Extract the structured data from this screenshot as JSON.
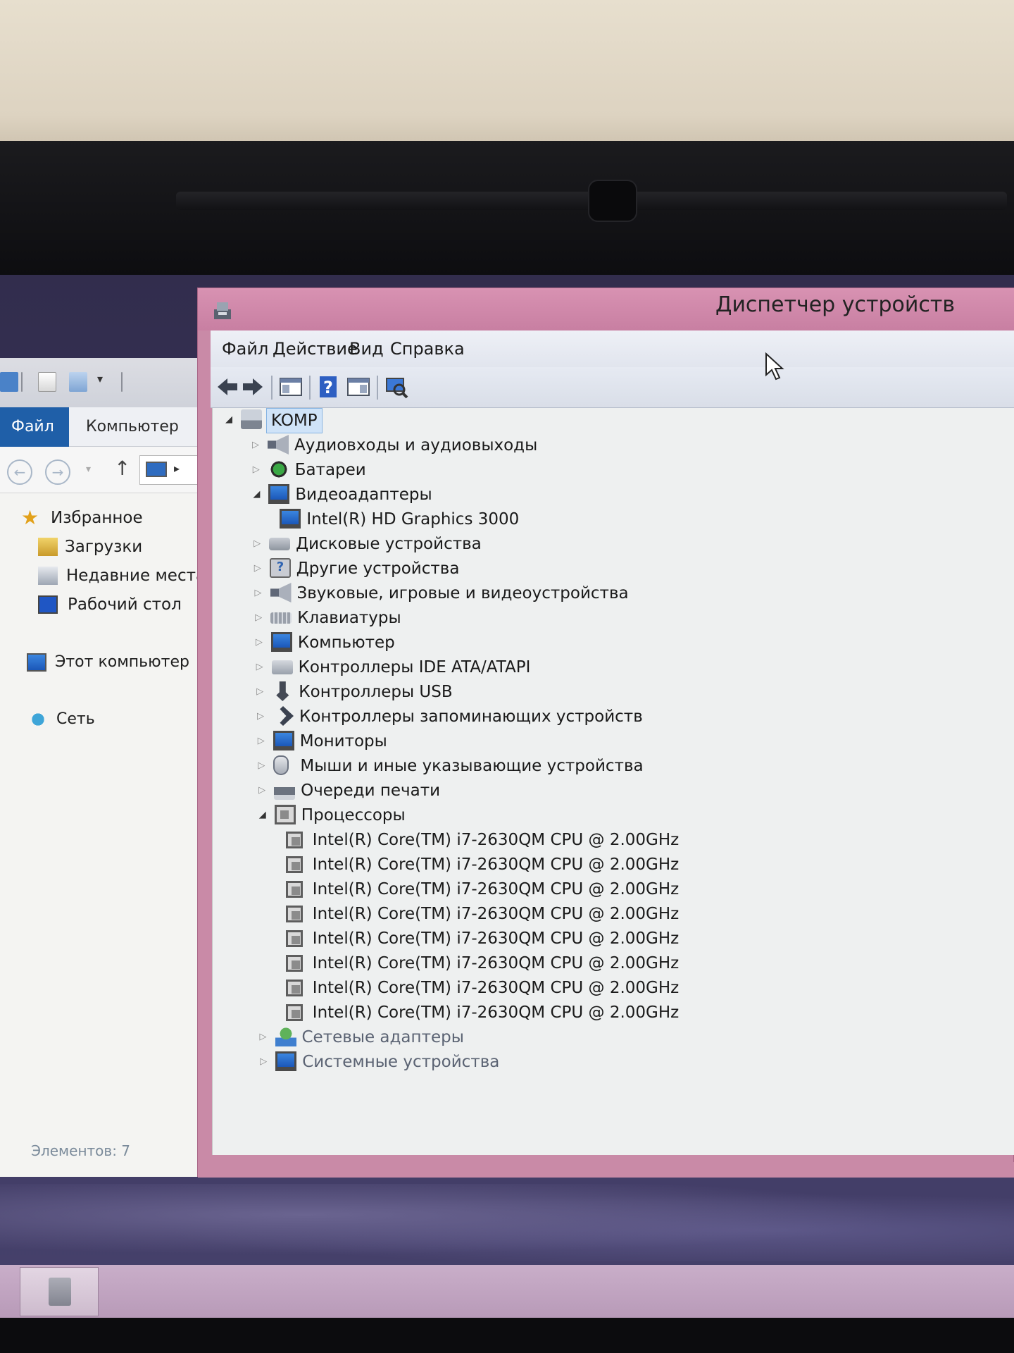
{
  "explorer": {
    "tabs": {
      "file": "Файл",
      "computer": "Компьютер"
    },
    "nav": {
      "favorites": "Избранное",
      "downloads": "Загрузки",
      "recent": "Недавние места",
      "desktop": "Рабочий стол",
      "this_pc": "Этот компьютер",
      "network": "Сеть"
    },
    "status": "Элементов: 7"
  },
  "device_manager": {
    "title": "Диспетчер устройств",
    "menu": [
      "Файл",
      "Действие",
      "Вид",
      "Справка"
    ],
    "tree": {
      "root": "KOMP",
      "categories": [
        {
          "label": "Аудиовходы и аудиовыходы",
          "icon": "speaker-icon",
          "expanded": false
        },
        {
          "label": "Батареи",
          "icon": "battery-icon",
          "expanded": false
        },
        {
          "label": "Видеоадаптеры",
          "icon": "monitor-icon",
          "expanded": true,
          "children": [
            "Intel(R) HD Graphics 3000"
          ]
        },
        {
          "label": "Дисковые устройства",
          "icon": "disk-icon",
          "expanded": false
        },
        {
          "label": "Другие устройства",
          "icon": "unknown-device-icon",
          "expanded": false
        },
        {
          "label": "Звуковые, игровые и видеоустройства",
          "icon": "speaker-icon",
          "expanded": false
        },
        {
          "label": "Клавиатуры",
          "icon": "keyboard-icon",
          "expanded": false
        },
        {
          "label": "Компьютер",
          "icon": "monitor-icon",
          "expanded": false
        },
        {
          "label": "Контроллеры IDE ATA/ATAPI",
          "icon": "ide-controller-icon",
          "expanded": false
        },
        {
          "label": "Контроллеры USB",
          "icon": "usb-icon",
          "expanded": false
        },
        {
          "label": "Контроллеры запоминающих устройств",
          "icon": "storage-controller-icon",
          "expanded": false
        },
        {
          "label": "Мониторы",
          "icon": "monitor-icon",
          "expanded": false
        },
        {
          "label": "Мыши и иные указывающие устройства",
          "icon": "mouse-icon",
          "expanded": false
        },
        {
          "label": "Очереди печати",
          "icon": "printer-icon",
          "expanded": false
        },
        {
          "label": "Процессоры",
          "icon": "cpu-icon",
          "expanded": true,
          "children": [
            "Intel(R) Core(TM) i7-2630QM CPU @ 2.00GHz",
            "Intel(R) Core(TM) i7-2630QM CPU @ 2.00GHz",
            "Intel(R) Core(TM) i7-2630QM CPU @ 2.00GHz",
            "Intel(R) Core(TM) i7-2630QM CPU @ 2.00GHz",
            "Intel(R) Core(TM) i7-2630QM CPU @ 2.00GHz",
            "Intel(R) Core(TM) i7-2630QM CPU @ 2.00GHz",
            "Intel(R) Core(TM) i7-2630QM CPU @ 2.00GHz",
            "Intel(R) Core(TM) i7-2630QM CPU @ 2.00GHz"
          ]
        },
        {
          "label": "Сетевые адаптеры",
          "icon": "network-icon",
          "expanded": false
        },
        {
          "label": "Системные устройства",
          "icon": "monitor-icon",
          "expanded": false
        }
      ]
    }
  },
  "colors": {
    "title_bar": "#c98aa7",
    "explorer_file_tab": "#1f5fa8",
    "root_selection": "#cfe3f8"
  }
}
